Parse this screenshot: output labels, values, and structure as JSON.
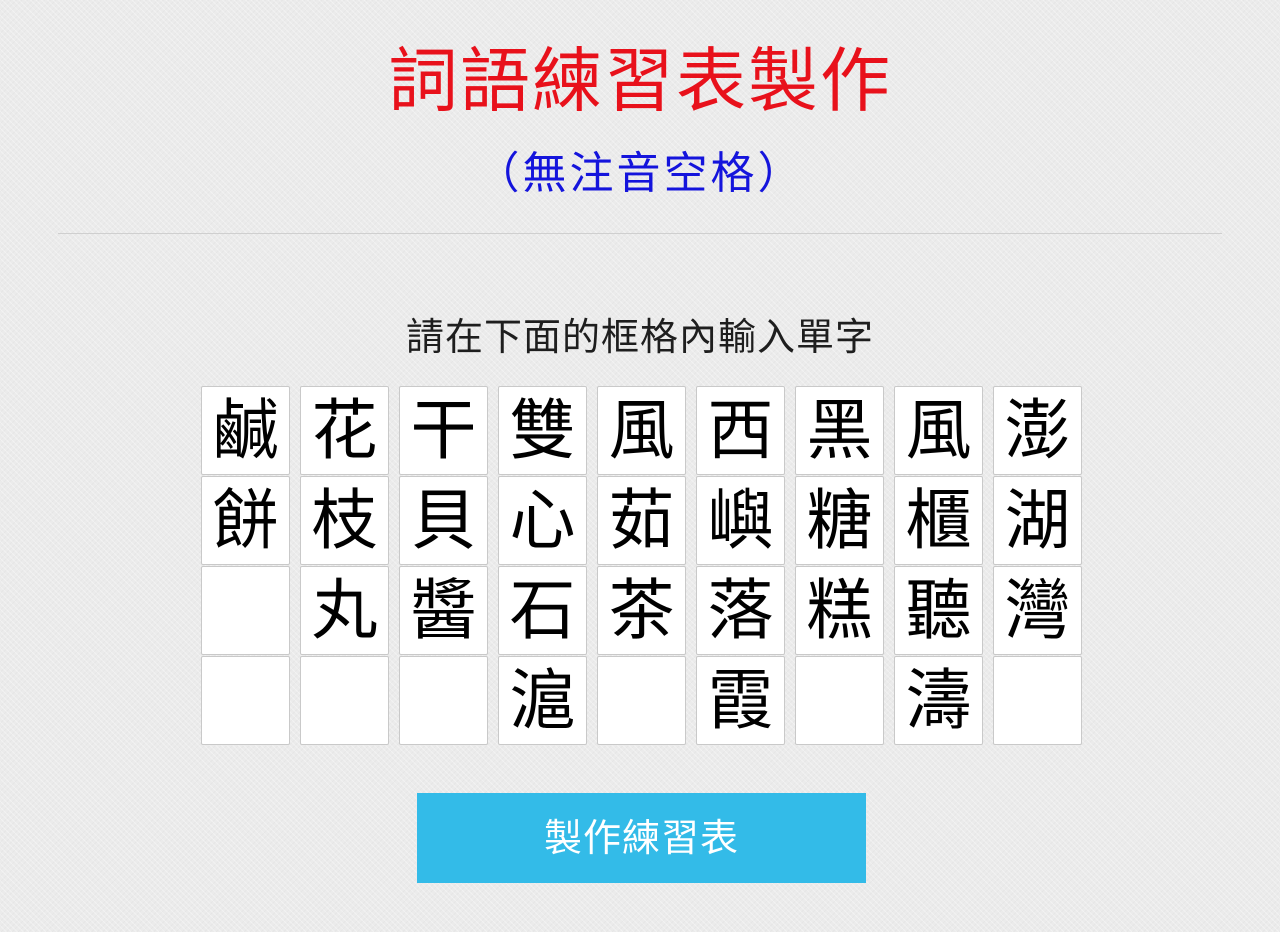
{
  "header": {
    "title": "詞語練習表製作",
    "subtitle": "（無注音空格）"
  },
  "instruction": "請在下面的框格內輸入單字",
  "grid": {
    "columns": [
      [
        "鹹",
        "餅",
        "",
        ""
      ],
      [
        "花",
        "枝",
        "丸",
        ""
      ],
      [
        "干",
        "貝",
        "醬",
        ""
      ],
      [
        "雙",
        "心",
        "石",
        "滬"
      ],
      [
        "風",
        "茹",
        "茶",
        ""
      ],
      [
        "西",
        "嶼",
        "落",
        "霞"
      ],
      [
        "黑",
        "糖",
        "糕",
        ""
      ],
      [
        "風",
        "櫃",
        "聽",
        "濤"
      ],
      [
        "澎",
        "湖",
        "灣",
        ""
      ]
    ]
  },
  "actions": {
    "make_button_label": "製作練習表"
  },
  "colors": {
    "title": "#e8111b",
    "subtitle": "#1414dc",
    "button": "#33bbe8"
  }
}
